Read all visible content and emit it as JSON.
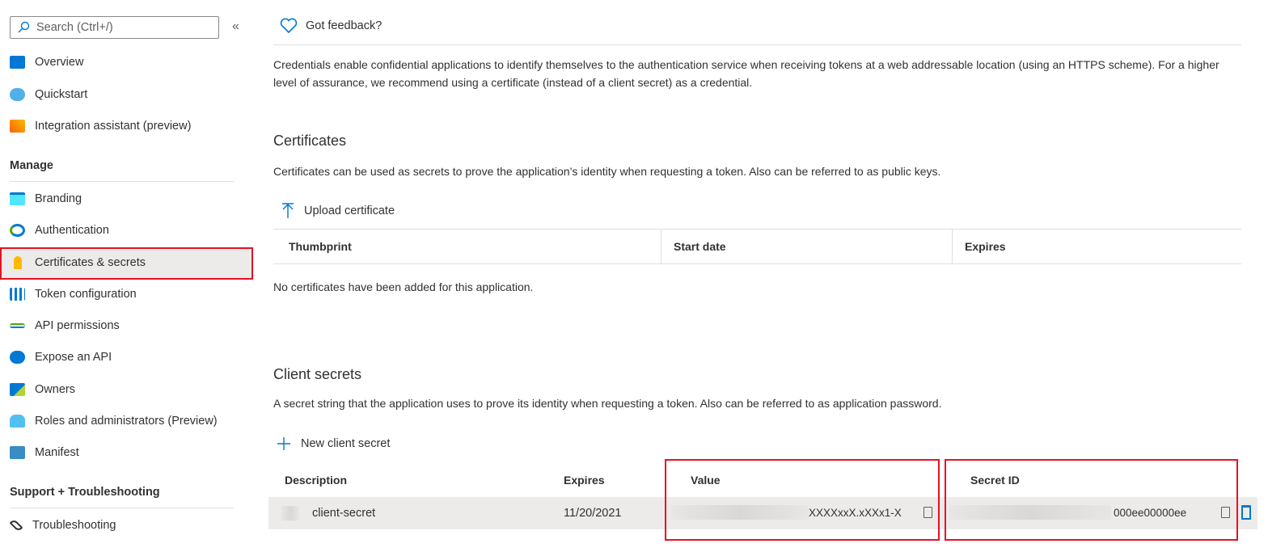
{
  "sidebar": {
    "search_placeholder": "Search (Ctrl+/)",
    "collapse": "«",
    "top_items": [
      {
        "label": "Overview",
        "icon": "overview-icon"
      },
      {
        "label": "Quickstart",
        "icon": "quickstart-icon"
      },
      {
        "label": "Integration assistant (preview)",
        "icon": "rocket-icon"
      }
    ],
    "manage_title": "Manage",
    "manage_items": [
      {
        "label": "Branding",
        "icon": "branding-icon"
      },
      {
        "label": "Authentication",
        "icon": "authentication-icon"
      },
      {
        "label": "Certificates & secrets",
        "icon": "key-icon",
        "selected": true
      },
      {
        "label": "Token configuration",
        "icon": "token-icon"
      },
      {
        "label": "API permissions",
        "icon": "api-permissions-icon"
      },
      {
        "label": "Expose an API",
        "icon": "cloud-icon"
      },
      {
        "label": "Owners",
        "icon": "owners-icon"
      },
      {
        "label": "Roles and administrators (Preview)",
        "icon": "roles-icon"
      },
      {
        "label": "Manifest",
        "icon": "manifest-icon"
      }
    ],
    "support_title": "Support + Troubleshooting",
    "support_items": [
      {
        "label": "Troubleshooting",
        "icon": "wrench-icon"
      }
    ]
  },
  "main": {
    "feedback": "Got feedback?",
    "intro": "Credentials enable confidential applications to identify themselves to the authentication service when receiving tokens at a web addressable location (using an HTTPS scheme). For a higher level of assurance, we recommend using a certificate (instead of a client secret) as a credential.",
    "certificates": {
      "title": "Certificates",
      "description": "Certificates can be used as secrets to prove the application’s identity when requesting a token. Also can be referred to as public keys.",
      "upload": "Upload certificate",
      "columns": [
        "Thumbprint",
        "Start date",
        "Expires"
      ],
      "empty": "No certificates have been added for this application."
    },
    "secrets": {
      "title": "Client secrets",
      "description": "A secret string that the application uses to prove its identity when requesting a token. Also can be referred to as application password.",
      "new": "New client secret",
      "columns": [
        "Description",
        "Expires",
        "Value",
        "Secret ID"
      ],
      "rows": [
        {
          "description": "client-secret",
          "expires": "11/20/2021",
          "value": "XXXXxxX.xXXx1-X",
          "secret_id": "000ee00000ee"
        }
      ]
    }
  },
  "colors": {
    "accent": "#0078d4",
    "highlight": "#e81123",
    "selected_bg": "#edebe9"
  }
}
